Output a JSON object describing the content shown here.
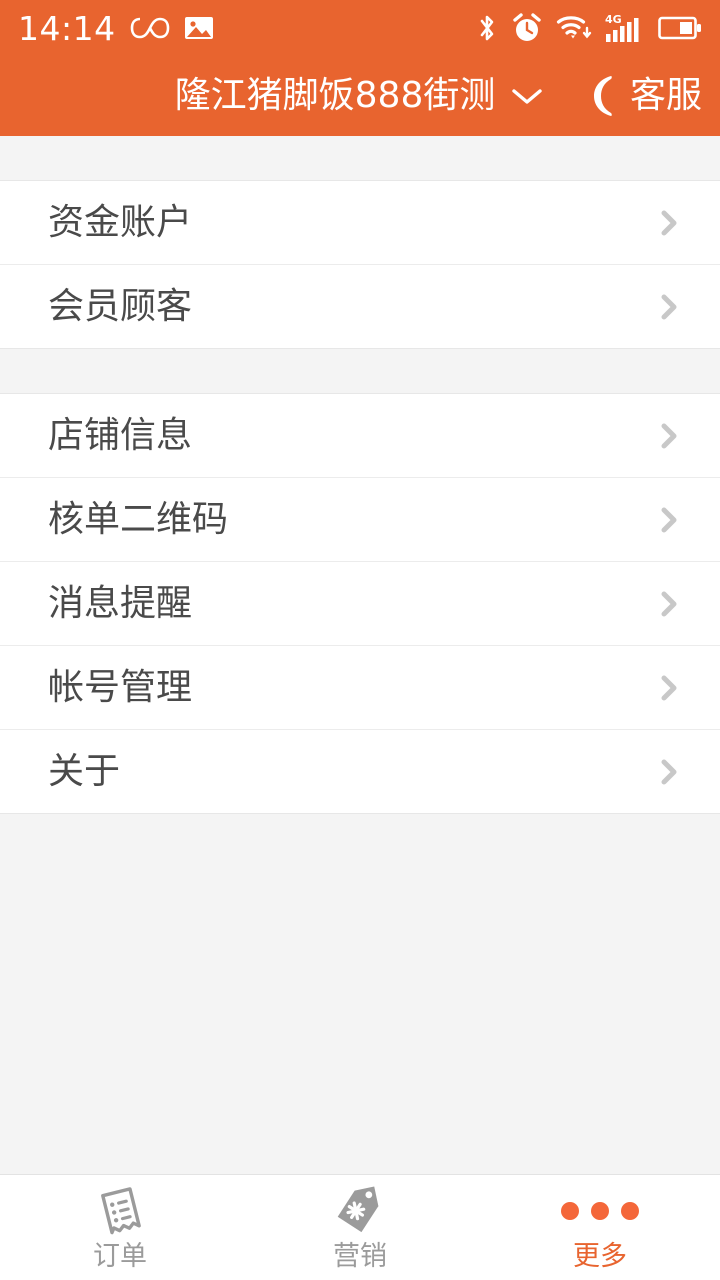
{
  "status_bar": {
    "time": "14:14",
    "left_icons": [
      "infinity-icon",
      "image-icon"
    ],
    "right_icons": [
      "bluetooth-icon",
      "alarm-clock-icon",
      "wifi-icon",
      "signal-4g-icon",
      "battery-icon"
    ],
    "background_color": "#e8642f"
  },
  "header": {
    "shop_name": "隆江猪脚饭888街测",
    "dropdown_icon": "chevron-down-icon",
    "service_label": "客服",
    "service_icon": "phone-icon",
    "background_color": "#e8642f",
    "text_color": "#ffffff"
  },
  "list": {
    "chevron_icon": "chevron-right-icon",
    "chevron_color": "#c8c8c8",
    "groups": [
      {
        "items": [
          {
            "label": "资金账户"
          },
          {
            "label": "会员顾客"
          }
        ]
      },
      {
        "items": [
          {
            "label": "店铺信息"
          },
          {
            "label": "核单二维码"
          },
          {
            "label": "消息提醒"
          },
          {
            "label": "帐号管理"
          },
          {
            "label": "关于"
          }
        ]
      }
    ]
  },
  "tab_bar": {
    "tabs": [
      {
        "label": "订单",
        "icon": "receipt-icon",
        "active": false
      },
      {
        "label": "营销",
        "icon": "price-tag-icon",
        "active": false
      },
      {
        "label": "更多",
        "icon": "more-dots-icon",
        "active": true
      }
    ],
    "active_color": "#e8642f",
    "inactive_color": "#9b9b9b"
  }
}
